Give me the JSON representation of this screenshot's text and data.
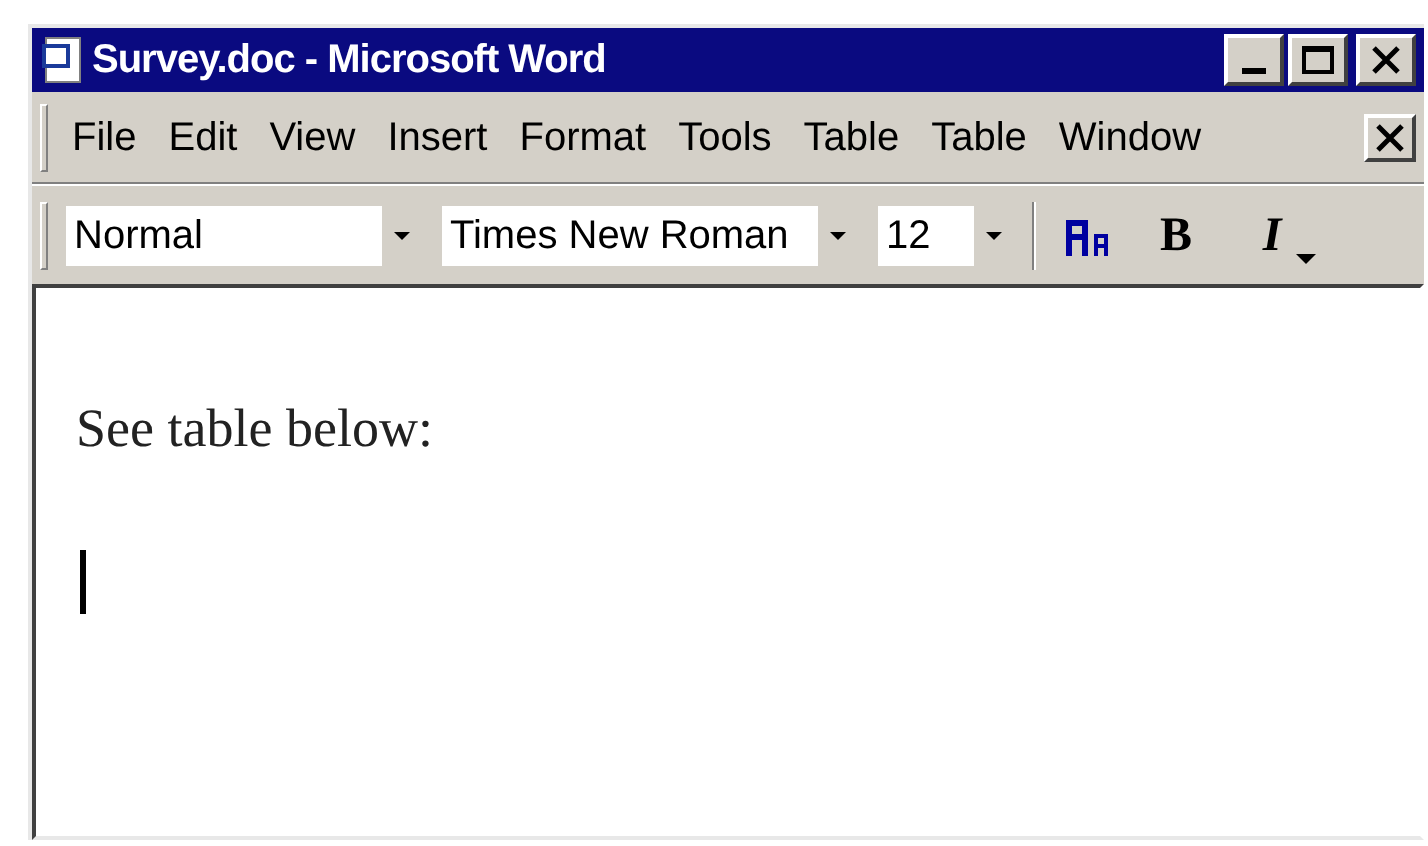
{
  "window": {
    "title": "Survey.doc - Microsoft Word"
  },
  "menu": [
    "File",
    "Edit",
    "View",
    "Insert",
    "Format",
    "Tools",
    "Table",
    "Table",
    "Window"
  ],
  "toolbar": {
    "style": "Normal",
    "font": "Times New Roman",
    "size": "12",
    "buttons": [
      {
        "kind": "icon"
      },
      {
        "kind": "bold",
        "label": "B"
      },
      {
        "kind": "italic",
        "label": "I"
      }
    ]
  },
  "document": {
    "paragraphs": [
      "See table below:"
    ]
  }
}
